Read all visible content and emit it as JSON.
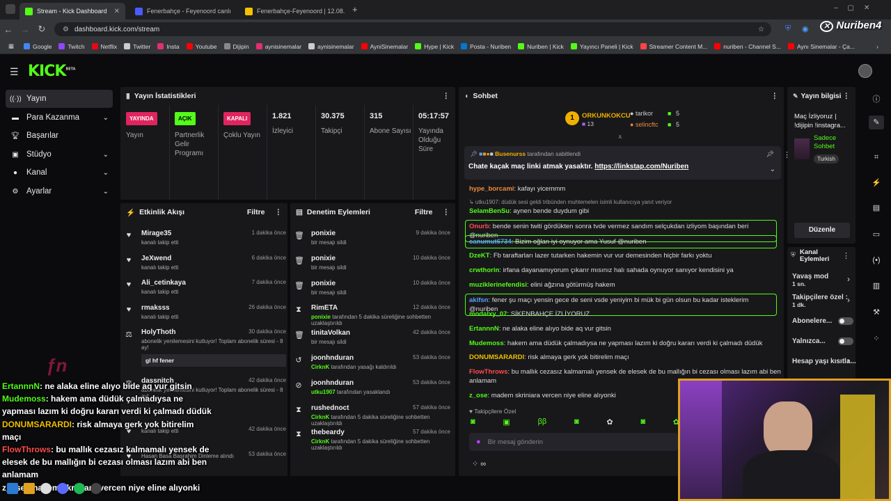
{
  "browser": {
    "tabs": [
      {
        "label": "Stream - Kick Dashboard",
        "color": "#53fc18"
      },
      {
        "label": "Fenerbahçe - Feyenoord canlı",
        "color": "#4a5cff"
      },
      {
        "label": "Fenerbahçe-Feyenoord | 12.08.",
        "color": "#f2c200"
      }
    ],
    "new_tab": "+",
    "url": "dashboard.kick.com/stream",
    "watermark": "Nuriben4",
    "bookmarks": [
      {
        "label": "Google",
        "color": "#4285f4"
      },
      {
        "label": "Twitch",
        "color": "#9146ff"
      },
      {
        "label": "Netflix",
        "color": "#e50914"
      },
      {
        "label": "Twitter",
        "color": "#cccccc"
      },
      {
        "label": "Insta",
        "color": "#e1306c"
      },
      {
        "label": "Youtube",
        "color": "#ff0000"
      },
      {
        "label": "Dijipin",
        "color": "#888888"
      },
      {
        "label": "aynisinemalar",
        "color": "#e1306c"
      },
      {
        "label": "aynisinemalar",
        "color": "#cccccc"
      },
      {
        "label": "AyniSinemalar",
        "color": "#ff0000"
      },
      {
        "label": "Hype | Kick",
        "color": "#53fc18"
      },
      {
        "label": "Posta - Nuriben",
        "color": "#0078d4"
      },
      {
        "label": "Nuriben | Kick",
        "color": "#53fc18"
      },
      {
        "label": "Yayıncı Paneli | Kick",
        "color": "#53fc18"
      },
      {
        "label": "Streamer Content M...",
        "color": "#ff4444"
      },
      {
        "label": "nuriben - Channel S...",
        "color": "#ff0000"
      },
      {
        "label": "Aynı Sinemalar - Ça...",
        "color": "#ff0000"
      }
    ]
  },
  "kick": {
    "logo": "KICK",
    "logo_beta": "BETA",
    "brand_color": "#53fc18"
  },
  "sidebar": {
    "items": [
      {
        "label": "Yayın",
        "icon": "broadcast-icon"
      },
      {
        "label": "Para Kazanma",
        "icon": "money-icon"
      },
      {
        "label": "Başarılar",
        "icon": "trophy-icon"
      },
      {
        "label": "Stüdyo",
        "icon": "studio-icon"
      },
      {
        "label": "Kanal",
        "icon": "user-icon"
      },
      {
        "label": "Ayarlar",
        "icon": "gear-icon"
      }
    ]
  },
  "stats": {
    "title": "Yayın İstatistikleri",
    "items": [
      {
        "badge": "YAYINDA",
        "badge_color": "#e0245e",
        "label": "Yayın"
      },
      {
        "badge": "AÇIK",
        "badge_color": "#53fc18",
        "label": "Partnerlik Gelir Programı"
      },
      {
        "badge": "KAPALI",
        "badge_color": "#e0245e",
        "label": "Çoklu Yayın"
      },
      {
        "value": "1.821",
        "label": "İzleyici"
      },
      {
        "value": "30.375",
        "label": "Takipçi"
      },
      {
        "value": "315",
        "label": "Abone Sayısı"
      },
      {
        "value": "05:17:57",
        "label": "Yayında Olduğu Süre"
      }
    ]
  },
  "activity": {
    "title": "Etkinlik Akışı",
    "filter": "Filtre",
    "rows": [
      {
        "name": "Mirage35",
        "sub": "kanalı takip etti",
        "time": "1 dakika önce"
      },
      {
        "name": "JeXwend",
        "sub": "kanalı takip etti",
        "time": "6 dakika önce"
      },
      {
        "name": "Ali_cetinkaya",
        "sub": "kanalı takip etti",
        "time": "7 dakika önce"
      },
      {
        "name": "rmaksss",
        "sub": "kanalı takip etti",
        "time": "26 dakika önce"
      },
      {
        "name": "HolyThoth",
        "sub": "abonelik yenilemesini kutluyor! Toplam abonelik süresi - 8 ay!",
        "time": "30 dakika önce",
        "msg": "gl hf fener"
      },
      {
        "name": "dassnitch",
        "sub": "abonelik yenilemesini kutluyor! Toplam abonelik süresi - 8 ay!",
        "time": "42 dakika önce"
      },
      {
        "name": "",
        "sub": "kanalı takip etti",
        "time": "42 dakika önce"
      },
      {
        "name": "",
        "sub": "Hasan Basa Başrahim Dinleme alındı",
        "time": "53 dakika önce"
      }
    ]
  },
  "moderation": {
    "title": "Denetim Eylemleri",
    "filter": "Filtre",
    "rows": [
      {
        "name": "ponixie",
        "sub": "bir mesajı sildi",
        "time": "9 dakika önce",
        "icon": "trash-icon"
      },
      {
        "name": "ponixie",
        "sub": "bir mesajı sildi",
        "time": "10 dakika önce",
        "icon": "trash-icon"
      },
      {
        "name": "ponixie",
        "sub": "bir mesajı sildi",
        "time": "10 dakika önce",
        "icon": "trash-icon"
      },
      {
        "name": "RimETA",
        "sub_user": "ponixie",
        "sub": "tarafından 5 dakika süreliğine sohbetten uzaklaştırıldı",
        "time": "12 dakika önce",
        "icon": "hourglass-icon"
      },
      {
        "name": "tinitaVolkan",
        "sub": "bir mesajı sildi",
        "time": "42 dakika önce",
        "icon": "trash-icon"
      },
      {
        "name": "joonhnduran",
        "sub_user": "CirknK",
        "sub": "tarafından yasağı kaldırıldı",
        "time": "53 dakika önce",
        "icon": "undo-icon"
      },
      {
        "name": "joonhnduran",
        "sub_user": "utku1907",
        "sub": "tarafından yasaklandı",
        "time": "53 dakika önce",
        "icon": "ban-icon"
      },
      {
        "name": "rushednoct",
        "sub_user": "CirknK",
        "sub": "tarafından 5 dakika süreliğine sohbetten uzaklaştırıldı",
        "time": "57 dakika önce",
        "icon": "hourglass-icon"
      },
      {
        "name": "thebeardy",
        "sub_user": "CirknK",
        "sub": "tarafından 5 dakika süreliğine sohbetten uzaklaştırıldı",
        "time": "57 dakika önce",
        "icon": "hourglass-icon"
      }
    ]
  },
  "chat": {
    "title": "Sohbet",
    "top_gifter": {
      "name": "ORKUNKOKCU",
      "count": "13",
      "rank": "1"
    },
    "gifters": [
      {
        "name": "tarikor",
        "count": "5"
      },
      {
        "name": "selincftc",
        "count": "5"
      }
    ],
    "pinned": {
      "by": "Busenurss",
      "by_suffix": "tarafından sabitlendi",
      "text": "Chate kaçak maç linki atmak yasaktır.",
      "link": "https://linkstap.com/Nuriben"
    },
    "messages": [
      {
        "user": "hype_borcami",
        "color": "#f08a3c",
        "text": "kafayı yicemmm"
      },
      {
        "user": "",
        "color": "#999999",
        "text": "↳ utku1907: düdük sesi geldi tribünden muhtemelen isimli kullanıcıya yanıt veriyor"
      },
      {
        "user": "SelamBenSu",
        "color": "#53fc18",
        "text": "aynen bende duydum gibi"
      },
      {
        "user": "Onurb",
        "color": "#ff4d4d",
        "text": "bende senin twiti gördükten sonra tvde vermez sandım selçukdan izliyom başından beri @nuriben",
        "hl": true
      },
      {
        "user": "canumut6734",
        "color": "#5aa0ff",
        "text": "Bizim oğlan iyi oynuyor ama Yusuf @nuriben",
        "hl": true
      },
      {
        "user": "DzeKT",
        "color": "#53fc18",
        "text": "Fb taraftarları lazer tutarken hakemin vur vur demesinden hiçbir farkı yoktu"
      },
      {
        "user": "crwthorin",
        "color": "#53fc18",
        "text": "irfana dayanamıyorum çıkarır mısınız halı sahada oynuyor sanıyor kendisini ya"
      },
      {
        "user": "muziklerinefendisi",
        "color": "#53fc18",
        "text": "elini ağzına götürmüş hakem"
      },
      {
        "user": "akifsn",
        "color": "#5aa0ff",
        "text": "fener şu maçı yensin gece de seni vsde yeniyim bi mük bi gün olsun bu kadar isteklerim @nuriben",
        "hl": true
      },
      {
        "user": "modalxy_07",
        "color": "#53fc18",
        "text": "SİKENBAHÇE İZLİYORUZ"
      },
      {
        "user": "ErtannnN",
        "color": "#53fc18",
        "text": "ne alaka eline alıyo bide aq vur gitsin"
      },
      {
        "user": "Mudemoss",
        "color": "#53fc18",
        "text": "hakem ama düdük çalmadıysa ne yapması lazım ki doğru kararı verdi ki çalmadı düdük"
      },
      {
        "user": "DONUMSARARDI",
        "color": "#f0c000",
        "text": "risk almaya gerk yok bitirelim maçı"
      },
      {
        "user": "FlowThrows",
        "color": "#ff4d4d",
        "text": "bu mallık cezasız kalmamalı yensek de elesek de bu mallığın bi cezası olması lazım abi ben anlamam"
      },
      {
        "user": "z_ose",
        "color": "#53fc18",
        "text": "madem skriniara vercen niye eline alıyonki"
      }
    ],
    "followers_only": "Takipçilere Özel",
    "input_placeholder": "Bir mesaj gönderin"
  },
  "stream_info": {
    "title": "Yayın bilgisi",
    "stream_title": "Maç İzliyoruz | !dijipin !instagra...",
    "category": "Sadece Sohbet",
    "language": "Turkish",
    "edit": "Düzenle"
  },
  "channel_actions": {
    "title": "Kanal Eylemleri",
    "items": [
      {
        "label": "Yavaş mod",
        "value": "1 sn.",
        "type": "arrow"
      },
      {
        "label": "Takipçilere özel :",
        "value": "1 dk.",
        "type": "arrow"
      },
      {
        "label": "Abonelere...",
        "type": "toggle"
      },
      {
        "label": "Yalnızca...",
        "type": "toggle"
      },
      {
        "label": "Hesap yaşı kısıtla...",
        "type": "arrow"
      }
    ]
  },
  "overlay": {
    "lines": [
      {
        "user": "ErtannnN",
        "color": "#53fc18",
        "text": ": ne alaka eline alıyo bide aq vur gitsin"
      },
      {
        "user": "Mudemoss",
        "color": "#53fc18",
        "text": ": hakem ama düdük çalmadıysa ne"
      },
      {
        "user": "",
        "color": "#ffffff",
        "text": "yapması lazım ki doğru kararı verdi ki çalmadı düdük"
      },
      {
        "user": "DONUMSARARDI",
        "color": "#f0c000",
        "text": ": risk almaya gerk yok bitirelim"
      },
      {
        "user": "",
        "color": "#ffffff",
        "text": "maçı"
      },
      {
        "user": "FlowThrows",
        "color": "#ff4d4d",
        "text": ": bu mallık cezasız kalmamalı yensek de"
      },
      {
        "user": "",
        "color": "#ffffff",
        "text": "elesek de bu mallığın bi cezası olması lazım abi ben"
      },
      {
        "user": "",
        "color": "#ffffff",
        "text": "anlamam"
      },
      {
        "user": "z_ose",
        "color": "#ffffff",
        "text": ": madem skriniara vercen niye eline alıyonki"
      }
    ]
  }
}
